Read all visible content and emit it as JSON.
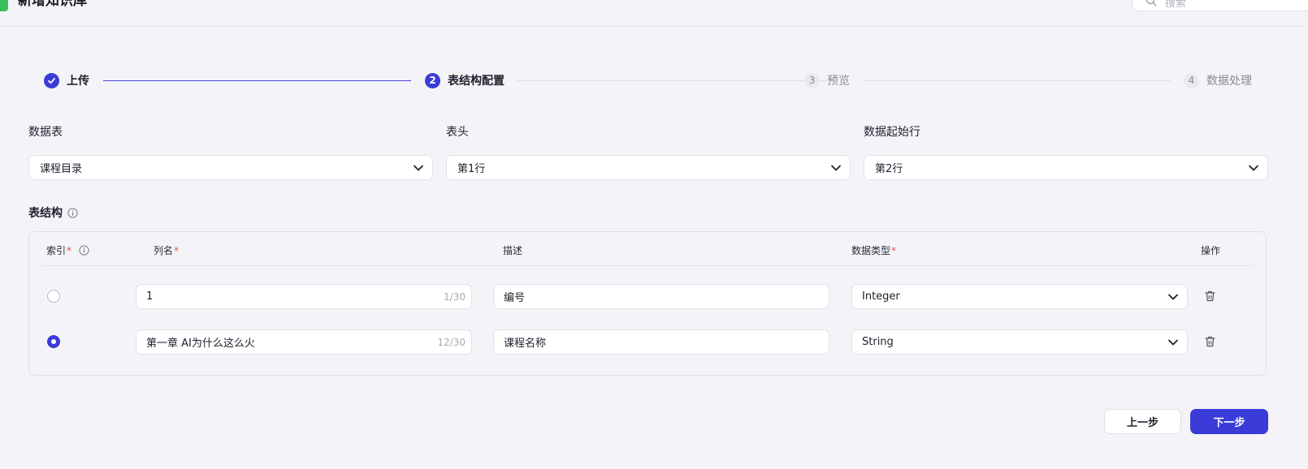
{
  "header": {
    "title": "新增知识库",
    "search_placeholder": "搜索"
  },
  "steps": [
    {
      "label": "上传",
      "state": "done",
      "number": ""
    },
    {
      "label": "表结构配置",
      "state": "active",
      "number": "2"
    },
    {
      "label": "预览",
      "state": "pending",
      "number": "3"
    },
    {
      "label": "数据处理",
      "state": "pending",
      "number": "4"
    }
  ],
  "config": {
    "table": {
      "label": "数据表",
      "value": "课程目录"
    },
    "header_row": {
      "label": "表头",
      "value": "第1行"
    },
    "data_start_row": {
      "label": "数据起始行",
      "value": "第2行"
    }
  },
  "structure": {
    "title": "表结构",
    "columns": {
      "index": "索引",
      "name": "列名",
      "description": "描述",
      "data_type": "数据类型",
      "actions": "操作"
    },
    "required_mark": "*",
    "rows": [
      {
        "is_index": false,
        "name": "1",
        "name_count": "1/30",
        "description": "编号",
        "data_type": "Integer"
      },
      {
        "is_index": true,
        "name": "第一章 AI为什么这么火",
        "name_count": "12/30",
        "description": "课程名称",
        "data_type": "String"
      }
    ]
  },
  "footer": {
    "prev_label": "上一步",
    "next_label": "下一步"
  },
  "colors": {
    "accent": "#3b3bd8",
    "required": "#e34b4b",
    "background": "#f4f4f8"
  }
}
